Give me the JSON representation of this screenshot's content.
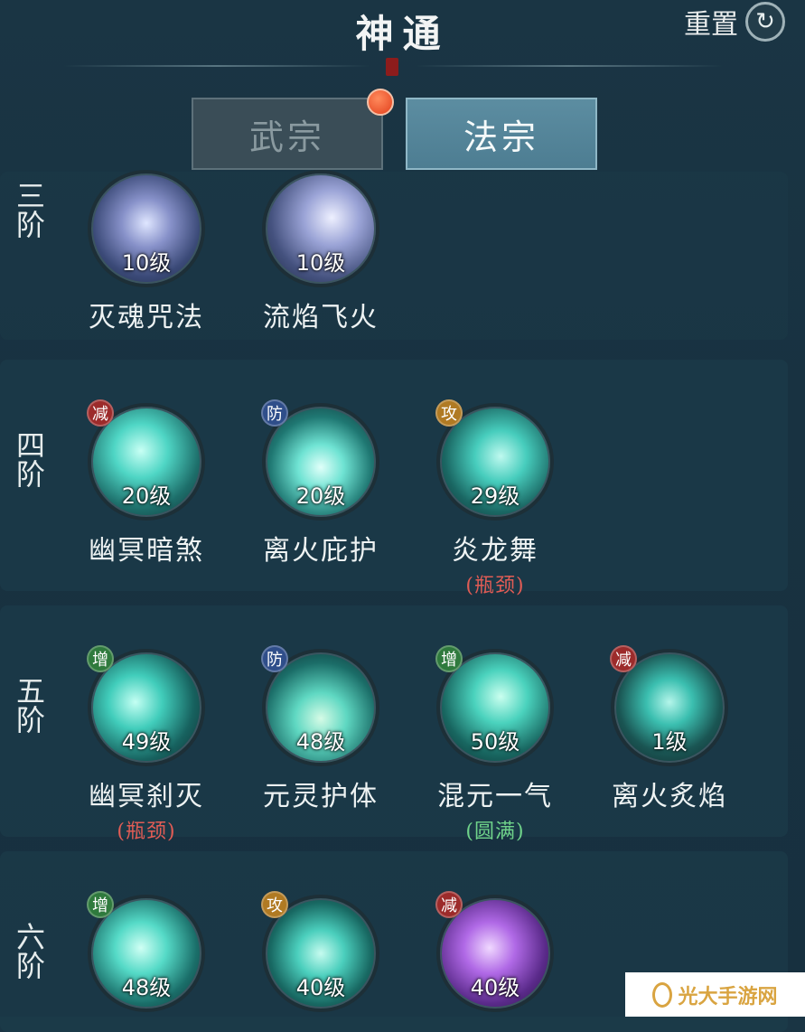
{
  "header": {
    "title": "神通",
    "reset_label": "重置",
    "reset_icon": "swirl-icon"
  },
  "tabs": [
    {
      "label": "武宗",
      "active": false
    },
    {
      "label": "法宗",
      "active": true
    }
  ],
  "tiers": [
    {
      "label": "三阶",
      "skills": [
        {
          "level": "10级",
          "name": "灭魂咒法",
          "art": "violet-slash"
        },
        {
          "level": "10级",
          "name": "流焰飞火",
          "art": "violet-fist"
        }
      ]
    },
    {
      "label": "四阶",
      "skills": [
        {
          "badge": "减",
          "badge_color": "#9c2b2b",
          "level": "20级",
          "name": "幽冥暗煞",
          "art": "teal-wings"
        },
        {
          "badge": "防",
          "badge_color": "#2f4e8a",
          "level": "20级",
          "name": "离火庇护",
          "art": "teal-lotus"
        },
        {
          "badge": "攻",
          "badge_color": "#b07a23",
          "level": "29级",
          "name": "炎龙舞",
          "status": "(瓶颈)",
          "status_type": "bottle",
          "art": "teal-vortex"
        }
      ]
    },
    {
      "label": "五阶",
      "skills": [
        {
          "badge": "增",
          "badge_color": "#2f7a3d",
          "level": "49级",
          "name": "幽冥刹灭",
          "status": "(瓶颈)",
          "status_type": "bottle",
          "art": "teal-swirl"
        },
        {
          "badge": "防",
          "badge_color": "#2f4e8a",
          "level": "48级",
          "name": "元灵护体",
          "art": "teal-mountain"
        },
        {
          "badge": "增",
          "badge_color": "#2f7a3d",
          "level": "50级",
          "name": "混元一气",
          "status": "(圆满)",
          "status_type": "full",
          "art": "teal-slash"
        },
        {
          "badge": "减",
          "badge_color": "#9c2b2b",
          "level": "1级",
          "name": "离火炙焰",
          "art": "teal-crystal"
        }
      ]
    },
    {
      "label": "六阶",
      "skills": [
        {
          "badge": "增",
          "badge_color": "#2f7a3d",
          "level": "48级",
          "art": "teal-shards"
        },
        {
          "badge": "攻",
          "badge_color": "#b07a23",
          "level": "40级",
          "art": "teal-dragon"
        },
        {
          "badge": "减",
          "badge_color": "#9c2b2b",
          "level": "40级",
          "art": "purple-orb"
        }
      ]
    }
  ],
  "colors": {
    "accent_teal": "#3fd1c6",
    "bottleneck": "#e05c55",
    "perfect": "#6fd38a",
    "notify_dot": "#e2401c"
  },
  "watermark": {
    "text": "光大手游网"
  }
}
